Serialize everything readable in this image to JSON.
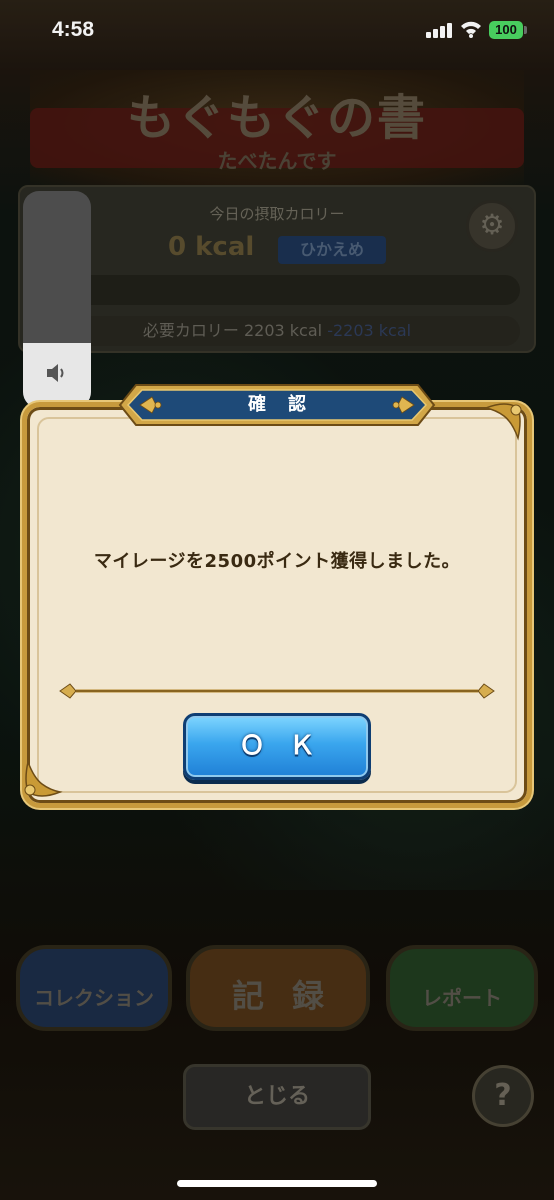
{
  "status_bar": {
    "time": "4:58",
    "battery": "100",
    "battery_color": "#4cd964"
  },
  "background": {
    "title": "もぐもぐの書",
    "subtitle": "たべたんです",
    "calorie_label": "今日の摂取カロリー",
    "calorie_value": "0 kcal",
    "calorie_badge": "ひかえめ",
    "required_label": "必要カロリー 2203 kcal",
    "required_diff": "-2203 kcal",
    "menu": {
      "collection": "コレクション",
      "record": "記録",
      "report": "レポート"
    },
    "close_label": "とじる",
    "help_label": "?"
  },
  "volume": {
    "level": 0.3
  },
  "dialog": {
    "title": "確認",
    "message": "マイレージを2500ポイント獲得しました。",
    "ok_label": "ＯＫ",
    "accent": "#c79a3d",
    "header_color": "#1e4a78"
  },
  "icons": [
    "signal-icon",
    "wifi-icon",
    "battery-icon",
    "speaker-icon",
    "gear-icon",
    "fleur-de-lis-icon",
    "corner-ornament-icon"
  ]
}
